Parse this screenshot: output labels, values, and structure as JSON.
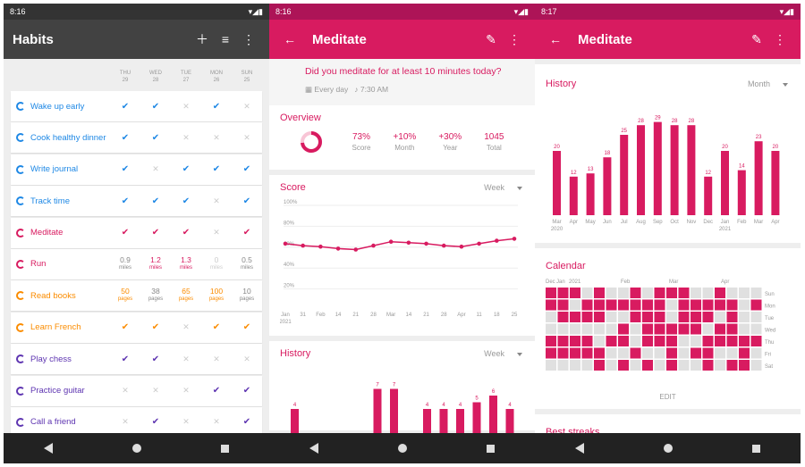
{
  "colors": {
    "bar_dark": "#424242",
    "bar_pink": "#c2185b",
    "status_pink": "#ad1457",
    "pink": "#e91e63",
    "blue": "#1e88e5",
    "orange": "#fb8c00",
    "purple": "#5e35b1"
  },
  "p1": {
    "time": "8:16",
    "title": "Habits",
    "icons": [
      "add-icon",
      "filter-icon",
      "more-vert-icon"
    ],
    "days": [
      {
        "d": "THU",
        "n": "29"
      },
      {
        "d": "WED",
        "n": "28"
      },
      {
        "d": "TUE",
        "n": "27"
      },
      {
        "d": "MON",
        "n": "26"
      },
      {
        "d": "SUN",
        "n": "25"
      }
    ],
    "habits": [
      {
        "name": "Wake up early",
        "color": "#1e88e5",
        "cells": [
          "✔",
          "✔",
          "✕",
          "✔",
          "✕"
        ]
      },
      {
        "name": "Cook healthy dinner",
        "color": "#1e88e5",
        "cells": [
          "✔",
          "✔",
          "✕",
          "✕",
          "✕"
        ]
      },
      {
        "name": "Write journal",
        "color": "#1e88e5",
        "cells": [
          "✔",
          "✕",
          "✔",
          "✔",
          "✔"
        ]
      },
      {
        "name": "Track time",
        "color": "#1e88e5",
        "cells": [
          "✔",
          "✔",
          "✔",
          "✕",
          "✔"
        ]
      },
      {
        "name": "Meditate",
        "color": "#d81b60",
        "cells": [
          "✔",
          "✔",
          "✔",
          "✕",
          "✔"
        ]
      },
      {
        "name": "Run",
        "color": "#d81b60",
        "cells": [
          "0.9|miles",
          "1.2|miles",
          "1.3|miles",
          "0|miles",
          "0.5|miles"
        ]
      },
      {
        "name": "Read books",
        "color": "#fb8c00",
        "cells": [
          "50|pages",
          "38|pages",
          "65|pages",
          "100|pages",
          "10|pages"
        ]
      },
      {
        "name": "Learn French",
        "color": "#fb8c00",
        "cells": [
          "✔",
          "✔",
          "✕",
          "✔",
          "✔"
        ]
      },
      {
        "name": "Play chess",
        "color": "#5e35b1",
        "cells": [
          "✔",
          "✔",
          "✕",
          "✕",
          "✕"
        ]
      },
      {
        "name": "Practice guitar",
        "color": "#5e35b1",
        "cells": [
          "✕",
          "✕",
          "✕",
          "✔",
          "✔"
        ]
      },
      {
        "name": "Call a friend",
        "color": "#5e35b1",
        "cells": [
          "✕",
          "✔",
          "✕",
          "✕",
          "✔"
        ]
      }
    ]
  },
  "p2": {
    "time": "8:16",
    "title": "Meditate",
    "question": "Did you meditate for at least 10 minutes today?",
    "frequency": "Every day",
    "reminder": "7:30 AM",
    "overview": {
      "title": "Overview",
      "ring_fraction": 0.73,
      "stats": [
        {
          "v": "73%",
          "l": "Score"
        },
        {
          "v": "+10%",
          "l": "Month"
        },
        {
          "v": "+30%",
          "l": "Year"
        },
        {
          "v": "1045",
          "l": "Total"
        }
      ]
    },
    "score": {
      "title": "Score",
      "period": "Week"
    },
    "history": {
      "title": "History",
      "period": "Week"
    }
  },
  "p3": {
    "time": "8:17",
    "title": "Meditate",
    "history": {
      "title": "History",
      "period": "Month"
    },
    "calendar": {
      "title": "Calendar",
      "months": [
        "Dec",
        "Jan",
        "2021",
        "Feb",
        "Mar",
        "Apr"
      ],
      "weekdays": [
        "Sun",
        "Mon",
        "Tue",
        "Wed",
        "Thu",
        "Fri",
        "Sat"
      ],
      "edit": "EDIT"
    },
    "streaks": {
      "title": "Best streaks"
    }
  },
  "chart_data": [
    {
      "type": "line",
      "title": "Score",
      "x": [
        "Jan 2021",
        "31",
        "Feb",
        "14",
        "21",
        "28",
        "Mar",
        "14",
        "21",
        "28",
        "Apr",
        "11",
        "18",
        "25"
      ],
      "y_ticks": [
        "100%",
        "80%",
        "60%",
        "40%",
        "20%"
      ],
      "values": [
        61,
        59,
        58,
        56,
        55,
        59,
        63,
        62,
        61,
        59,
        58,
        61,
        64,
        66
      ],
      "ylim": [
        0,
        100
      ]
    },
    {
      "type": "bar",
      "title": "History",
      "categories": [
        "Mar 2020",
        "Apr",
        "May",
        "Jun",
        "Jul",
        "Aug",
        "Sep",
        "Oct",
        "Nov",
        "Dec",
        "Jan 2021",
        "Feb",
        "Mar",
        "Apr"
      ],
      "values": [
        20,
        12,
        13,
        18,
        25,
        28,
        29,
        28,
        28,
        12,
        20,
        14,
        23,
        20
      ]
    },
    {
      "type": "bar",
      "title": "History (week)",
      "values": [
        4,
        0,
        0,
        0,
        0,
        7,
        7,
        0,
        4,
        4,
        4,
        5,
        6,
        4
      ]
    }
  ]
}
